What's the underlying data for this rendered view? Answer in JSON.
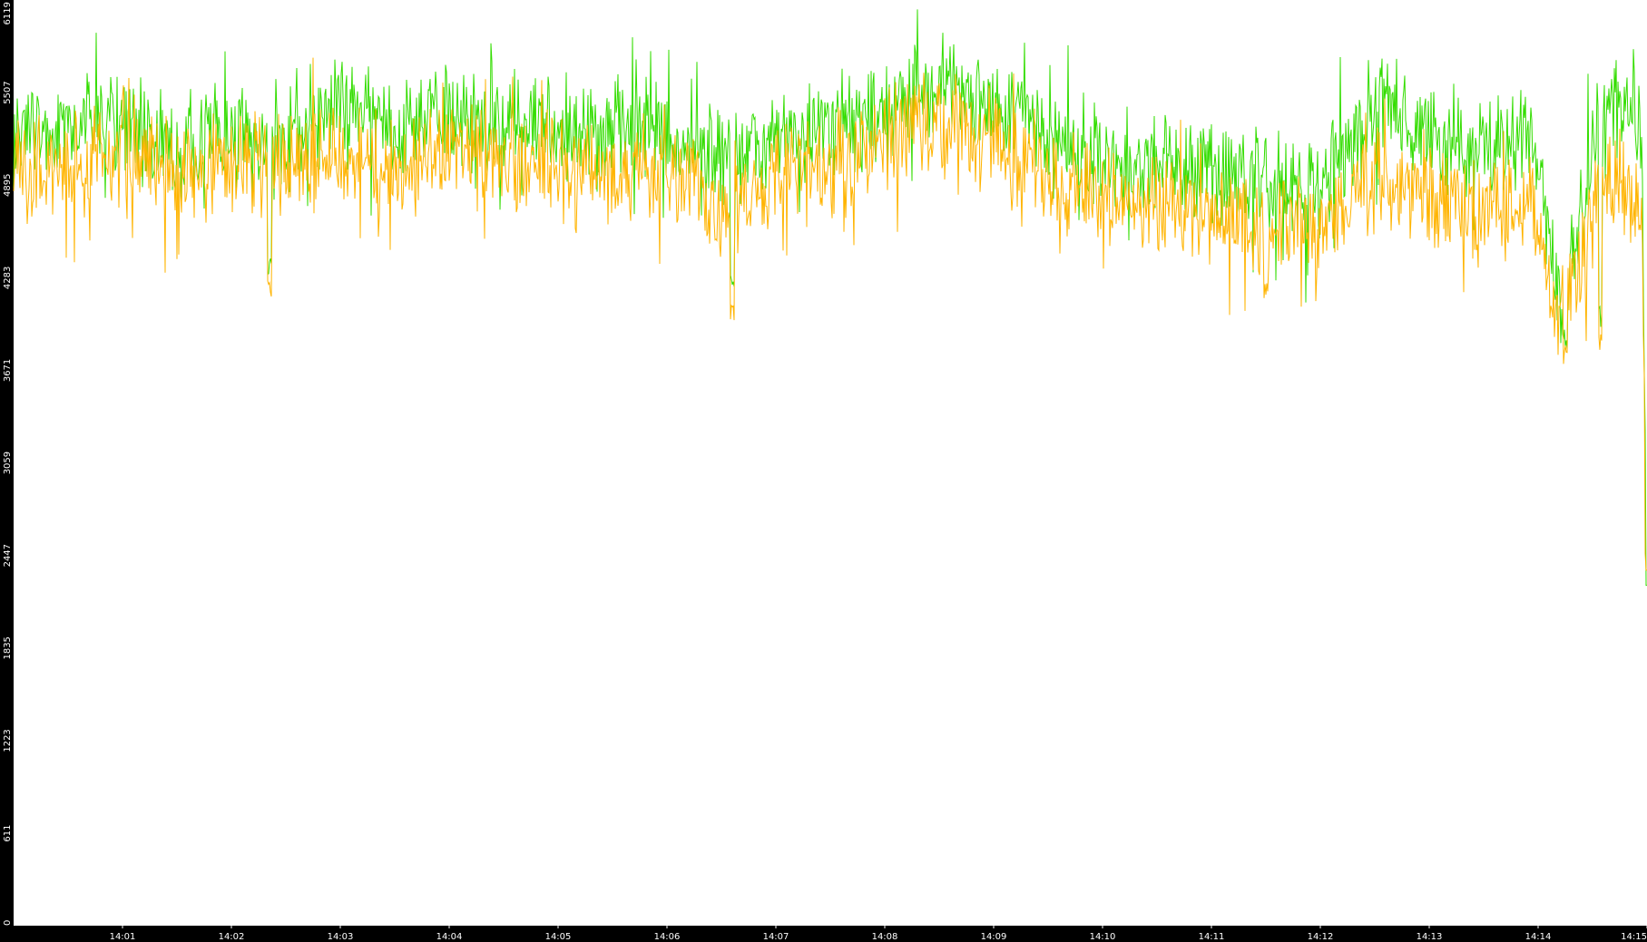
{
  "chart_data": {
    "type": "line",
    "title": "",
    "xlabel": "",
    "ylabel": "",
    "ylim": [
      0,
      6119
    ],
    "yticks": [
      "0",
      "611",
      "1223",
      "1835",
      "2447",
      "3059",
      "3671",
      "4283",
      "4895",
      "5507",
      "6119"
    ],
    "xticks": [
      "14:01",
      "14:02",
      "14:03",
      "14:04",
      "14:05",
      "14:06",
      "14:07",
      "14:08",
      "14:09",
      "14:10",
      "14:11",
      "14:12",
      "14:13",
      "14:14",
      "14:15"
    ],
    "x_range_minutes": [
      "14:00",
      "14:15"
    ],
    "grid": false,
    "legend": "none",
    "series": [
      {
        "color": "#33dd00",
        "anchors": [
          [
            0.0,
            5250
          ],
          [
            0.5,
            5300
          ],
          [
            1.0,
            5350
          ],
          [
            1.5,
            5100
          ],
          [
            2.0,
            5300
          ],
          [
            2.5,
            5200
          ],
          [
            3.0,
            5450
          ],
          [
            3.5,
            5300
          ],
          [
            4.0,
            5350
          ],
          [
            4.5,
            5300
          ],
          [
            5.0,
            5250
          ],
          [
            5.5,
            5300
          ],
          [
            6.0,
            5250
          ],
          [
            6.5,
            5050
          ],
          [
            7.0,
            5200
          ],
          [
            7.5,
            5300
          ],
          [
            8.0,
            5350
          ],
          [
            8.5,
            5600
          ],
          [
            9.0,
            5400
          ],
          [
            9.5,
            5250
          ],
          [
            10.0,
            5050
          ],
          [
            10.5,
            5100
          ],
          [
            11.0,
            5000
          ],
          [
            11.5,
            4900
          ],
          [
            12.0,
            4850
          ],
          [
            12.5,
            5450
          ],
          [
            13.0,
            5250
          ],
          [
            13.5,
            5150
          ],
          [
            13.95,
            5250
          ],
          [
            14.2,
            4050
          ],
          [
            14.4,
            4750
          ],
          [
            14.6,
            5400
          ],
          [
            14.95,
            5250
          ],
          [
            15.0,
            2250
          ]
        ],
        "dips": [
          [
            2.35,
            4300
          ],
          [
            6.6,
            4200
          ],
          [
            14.25,
            3800
          ],
          [
            14.57,
            3950
          ]
        ]
      },
      {
        "color": "#ffb400",
        "anchors": [
          [
            0.0,
            4950
          ],
          [
            0.5,
            5000
          ],
          [
            1.0,
            5200
          ],
          [
            1.5,
            4950
          ],
          [
            2.0,
            5050
          ],
          [
            2.5,
            5000
          ],
          [
            3.0,
            5100
          ],
          [
            3.5,
            5000
          ],
          [
            4.0,
            5100
          ],
          [
            4.5,
            5050
          ],
          [
            5.0,
            5000
          ],
          [
            5.5,
            4950
          ],
          [
            6.0,
            5050
          ],
          [
            6.5,
            4700
          ],
          [
            7.0,
            4950
          ],
          [
            7.5,
            5050
          ],
          [
            8.0,
            5200
          ],
          [
            8.5,
            5350
          ],
          [
            9.0,
            5150
          ],
          [
            9.5,
            4950
          ],
          [
            10.0,
            4850
          ],
          [
            10.5,
            4750
          ],
          [
            11.0,
            4700
          ],
          [
            11.5,
            4600
          ],
          [
            12.0,
            4600
          ],
          [
            12.5,
            4950
          ],
          [
            13.0,
            4800
          ],
          [
            13.5,
            4750
          ],
          [
            13.95,
            4800
          ],
          [
            14.2,
            3950
          ],
          [
            14.4,
            4500
          ],
          [
            14.6,
            4950
          ],
          [
            14.95,
            4800
          ],
          [
            15.0,
            2350
          ]
        ],
        "dips": [
          [
            2.35,
            4150
          ],
          [
            6.6,
            3950
          ],
          [
            11.5,
            4100
          ],
          [
            14.25,
            3700
          ],
          [
            14.57,
            3800
          ]
        ]
      }
    ]
  }
}
